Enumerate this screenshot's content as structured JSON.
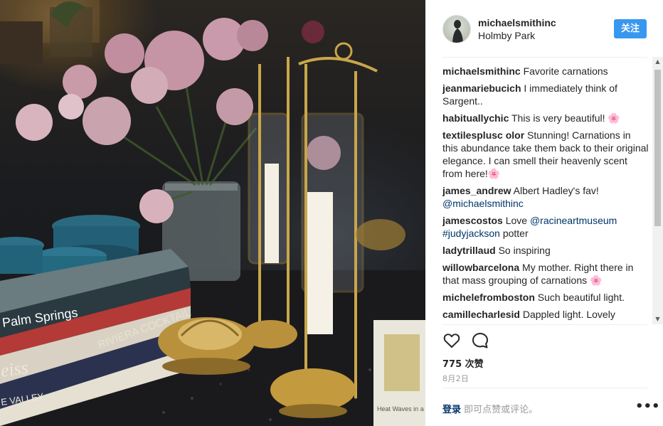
{
  "header": {
    "username": "michaelsmithinc",
    "location": "Holmby Park",
    "follow_label": "关注"
  },
  "comments": [
    {
      "user": "michaelsmithinc",
      "text": "Favorite carnations"
    },
    {
      "user": "jeanmariebucich",
      "text": "I immediately think of Sargent.."
    },
    {
      "user": "habituallychic",
      "text": "This is very beautiful! 🌸"
    },
    {
      "user": "textilesplusc olor",
      "text": "Stunning! Carnations in this abundance take them back to their original elegance. I can smell their heavenly scent from here!🌸"
    },
    {
      "user": "james_andrew",
      "text": "Albert Hadley's fav! ",
      "mention": "@michaelsmithinc"
    },
    {
      "user": "jamescostos",
      "text": "Love ",
      "mention": "@racineartmuseum",
      "tag": "#judyjackson",
      "tail": " potter"
    },
    {
      "user": "ladytrillaud",
      "text": "So inspiring"
    },
    {
      "user": "willowbarcelona",
      "text": "My mother. Right there in that mass grouping of carnations 🌸"
    },
    {
      "user": "michelefromboston",
      "text": "Such beautiful light."
    },
    {
      "user": "camillecharlesid",
      "text": "Dappled light. Lovely"
    }
  ],
  "actions": {
    "like_icon": "heart-icon",
    "comment_icon": "comment-icon"
  },
  "likes": "775 次赞",
  "date": "8月2日",
  "login": {
    "link": "登录",
    "text": " 即可点赞或评论。"
  },
  "more_icon": "more-icon",
  "photo": {
    "book_titles": [
      "Palm Springs",
      "RIVIERA COCKTAIL",
      "eiss",
      "E VALLEY",
      "Heat Waves in a Swamp"
    ]
  },
  "colors": {
    "accent": "#3897f0",
    "link": "#003569"
  }
}
